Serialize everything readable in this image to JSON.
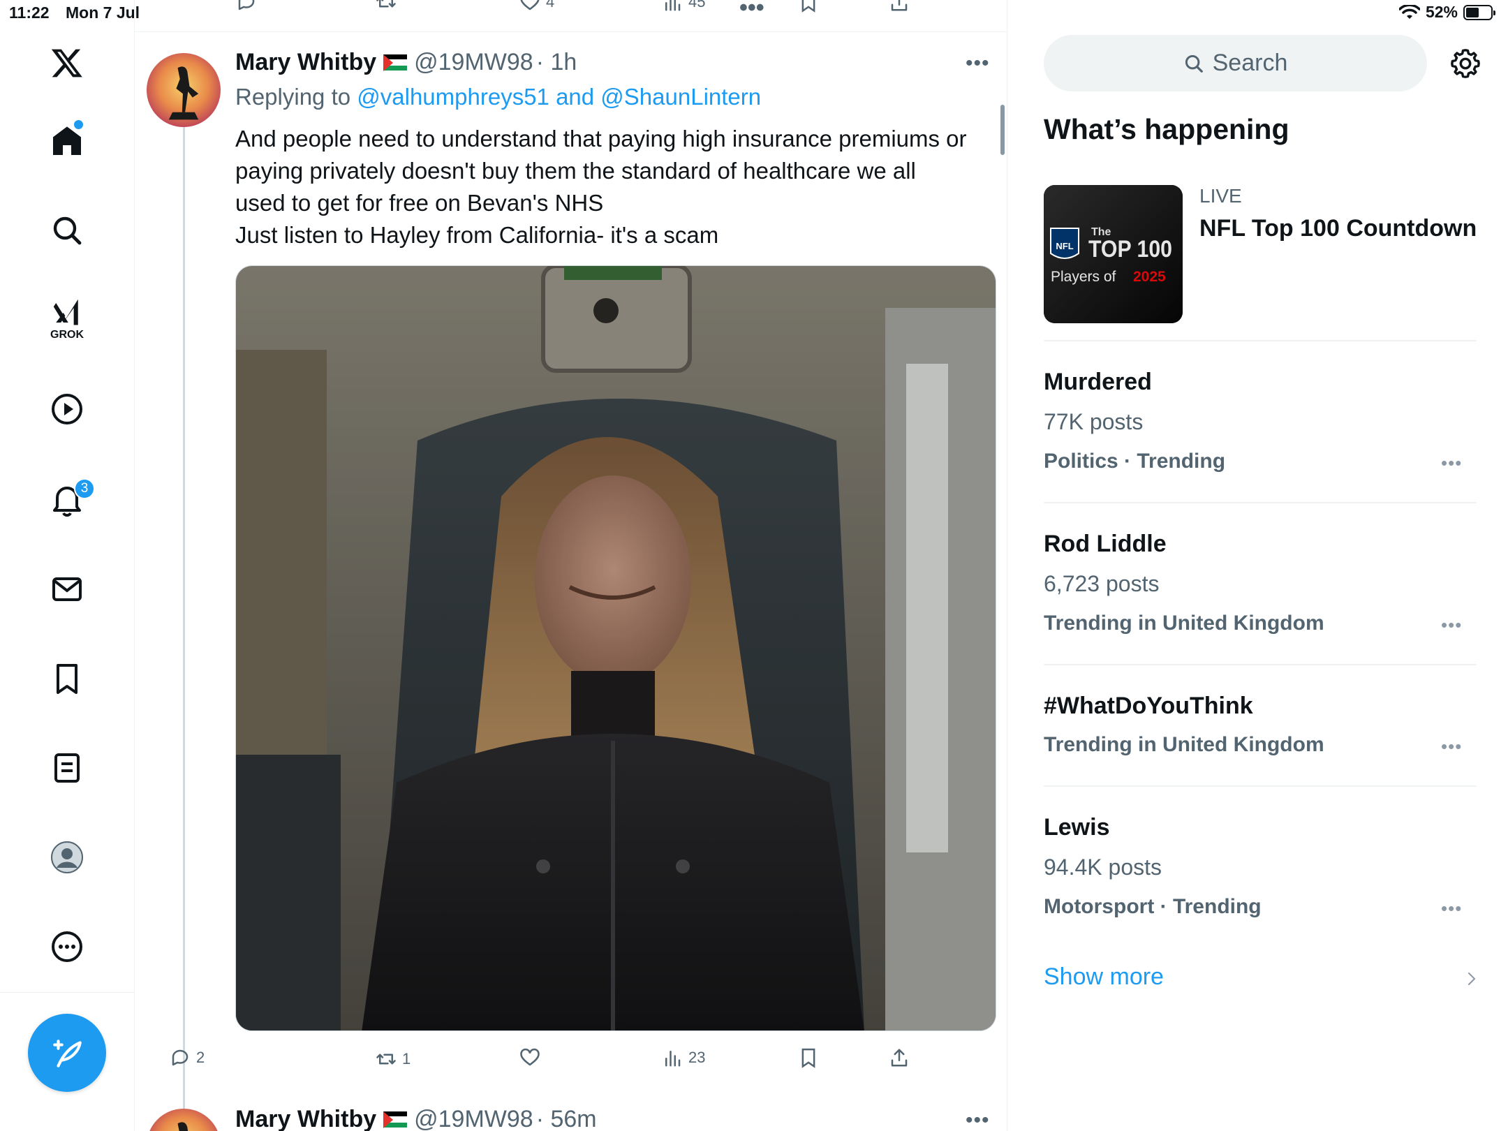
{
  "status_bar": {
    "time": "11:22",
    "date": "Mon 7 Jul",
    "battery": "52%",
    "battery_level": 0.52
  },
  "nav": {
    "notifications_badge": "3",
    "grok_label": "GROK"
  },
  "prev_tweet_actions": {
    "likes": "4",
    "views": "45"
  },
  "tweet": {
    "name": "Mary Whitby",
    "handle": "@19MW98",
    "time": "· 1h",
    "replying_prefix": "Replying to ",
    "replying_to": "@valhumphreys51 and @ShaunLintern",
    "text_line1": "And people need to understand that paying high insurance premiums or",
    "text_line2": "paying privately doesn't buy them the standard of healthcare we all",
    "text_line3": "used to get for free on Bevan's NHS",
    "text_line4": "Just listen to Hayley from California- it's a scam",
    "replies": "2",
    "retweets": "1",
    "views": "23"
  },
  "next_tweet": {
    "name": "Mary Whitby",
    "handle": "@19MW98",
    "time": "· 56m"
  },
  "sidebar": {
    "search_placeholder": "Search",
    "section_title": "What’s happening",
    "live_label": "LIVE",
    "live_title": "NFL Top 100 Countdown",
    "nfl_thumb": {
      "brand": "NFL",
      "the": "The",
      "top100": "TOP 100",
      "players_of": "Players of",
      "year": "2025"
    },
    "trends": [
      {
        "title": "Murdered",
        "posts": "77K posts",
        "category": "Politics · Trending"
      },
      {
        "title": "Rod Liddle",
        "posts": "6,723 posts",
        "category": "Trending in United Kingdom"
      },
      {
        "title": "#WhatDoYouThink",
        "posts": "",
        "category": "Trending in United Kingdom"
      },
      {
        "title": "Lewis",
        "posts": "94.4K posts",
        "category": "Motorsport · Trending"
      }
    ],
    "show_more": "Show more"
  },
  "colors": {
    "accent": "#1d9bf0",
    "text": "#0f1419",
    "secondary": "#536471",
    "border": "#eff3f4"
  }
}
